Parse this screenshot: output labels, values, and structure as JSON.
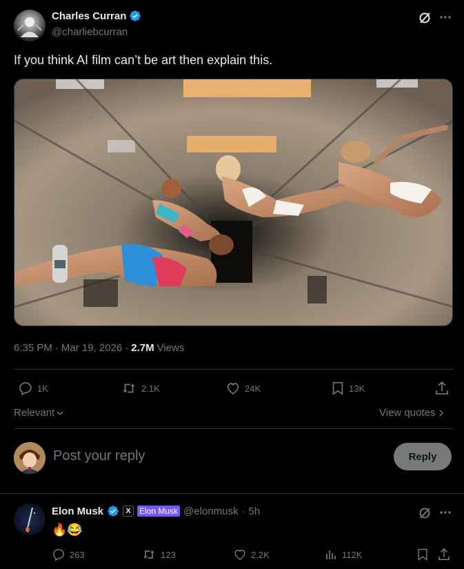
{
  "post": {
    "author_name": "Charles Curran",
    "author_handle": "@charliebcurran",
    "text": "If you think AI film can’t be art then explain this.",
    "time": "6:35 PM",
    "dot": "·",
    "date": "Mar 19, 2026",
    "views_count": "2.7M",
    "views_label": "Views",
    "actions": {
      "replies": "1K",
      "reposts": "2.1K",
      "likes": "24K",
      "bookmarks": "13K"
    },
    "relevant_label": "Relevant",
    "view_quotes_label": "View quotes"
  },
  "composer": {
    "placeholder": "Post your reply",
    "reply_button": "Reply"
  },
  "reply": {
    "author_name": "Elon Musk",
    "x_badge": "X",
    "affiliation": "Elon Musk",
    "author_handle": "@elonmusk",
    "dot": "·",
    "time": "5h",
    "text": "🔥😂",
    "actions": {
      "replies": "263",
      "reposts": "123",
      "likes": "2.2K",
      "views": "112K"
    }
  },
  "colors": {
    "background": "#000000",
    "text": "#e7e9ea",
    "muted": "#71767b",
    "verified": "#1d9bf0",
    "divider": "#2f3336",
    "affiliation_badge": "#7856ff"
  }
}
